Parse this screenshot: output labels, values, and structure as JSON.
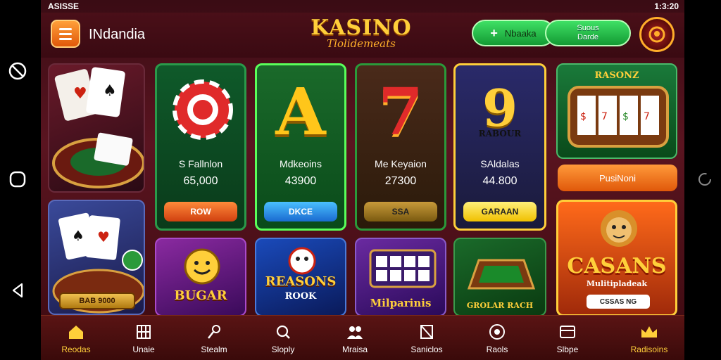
{
  "status_bar": {
    "left": "ASISSE",
    "time": "1:3:20"
  },
  "header": {
    "app_name": "INdandia",
    "logo_line1": "KASINO",
    "logo_line2": "Tlolidemeats",
    "deposit_label": "Nbaaka",
    "second_pill": [
      "Suous",
      "Darde"
    ]
  },
  "cards": [
    {
      "symbol": "0",
      "name": "S Fallnlon",
      "amount": "65,000",
      "button": "ROW"
    },
    {
      "symbol": "A",
      "name": "Mdkeoins",
      "amount": "43900",
      "button": "DKCE"
    },
    {
      "symbol": "7",
      "name": "Me Keyaion",
      "amount": "27300",
      "button": "SSA"
    },
    {
      "symbol": "9",
      "sub": "RABOUR",
      "name": "SAldalas",
      "amount": "44.800",
      "button": "GARAAN"
    }
  ],
  "slot_card": {
    "title": "RASONZ",
    "button": "PusiNoni"
  },
  "bottom_tiles": [
    {
      "title": "BUGAR"
    },
    {
      "title": "REASONS",
      "sub": "ROOK"
    },
    {
      "title": "Milparinis"
    },
    {
      "title": "GROLAR RACH"
    }
  ],
  "promo_card": {
    "title": "CASANS",
    "sub": "Mulitipladeak",
    "button": "CSSAS NG"
  },
  "left_tile_button": "BAB 9000",
  "bottom_nav": [
    {
      "label": "Reodas",
      "icon": "home-icon",
      "active": true
    },
    {
      "label": "Unaie",
      "icon": "grid-icon",
      "active": false
    },
    {
      "label": "Stealm",
      "icon": "tool-icon",
      "active": false
    },
    {
      "label": "Sloply",
      "icon": "search-icon",
      "active": false
    },
    {
      "label": "Mraisa",
      "icon": "people-icon",
      "active": false
    },
    {
      "label": "Saniclos",
      "icon": "flag-icon",
      "active": false
    },
    {
      "label": "Raols",
      "icon": "target-icon",
      "active": false
    },
    {
      "label": "Slbpe",
      "icon": "store-icon",
      "active": false
    },
    {
      "label": "Radisoins",
      "icon": "crown-icon",
      "active": true
    }
  ],
  "colors": {
    "accent_gold": "#ffcf3a",
    "bg": "#4a0f18",
    "green": "#2fcf55"
  }
}
